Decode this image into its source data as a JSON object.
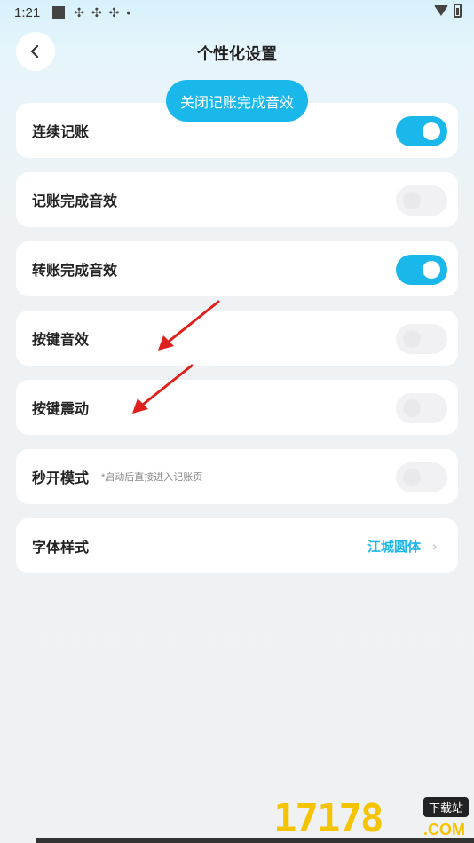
{
  "status_bar": {
    "time": "1:21",
    "dots": "•"
  },
  "header": {
    "title": "个性化设置"
  },
  "toast": {
    "text": "关闭记账完成音效"
  },
  "settings": [
    {
      "label": "连续记账",
      "toggle": "on"
    },
    {
      "label": "记账完成音效",
      "toggle": "off"
    },
    {
      "label": "转账完成音效",
      "toggle": "on"
    },
    {
      "label": "按键音效",
      "toggle": "off"
    },
    {
      "label": "按键震动",
      "toggle": "off"
    },
    {
      "label": "秒开模式",
      "hint": "*启动后直接进入记账页",
      "toggle": "off"
    }
  ],
  "font_style": {
    "label": "字体样式",
    "value": "江城圆体",
    "chevron": "›"
  },
  "watermark": {
    "digits": "17178",
    "tag": "下载站",
    "com": ".COM"
  },
  "colors": {
    "accent": "#1ab7ea",
    "arrow": "#e0201c"
  }
}
